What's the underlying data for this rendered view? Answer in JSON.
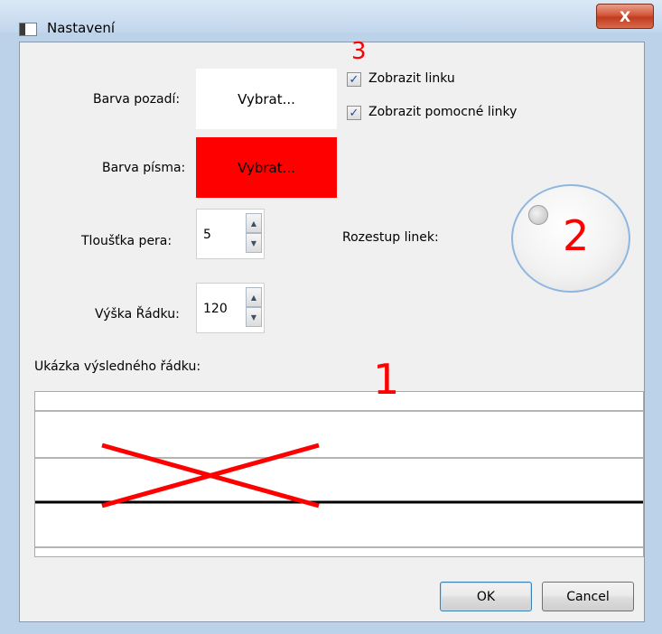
{
  "window": {
    "title": "Nastavení",
    "close_label": "X"
  },
  "form": {
    "background_color": {
      "label": "Barva pozadí:",
      "button_label": "Vybrat...",
      "color": "#ffffff"
    },
    "font_color": {
      "label": "Barva písma:",
      "button_label": "Vybrat...",
      "color": "#ff0000"
    },
    "pen_thickness": {
      "label": "Tloušťka pera:",
      "value": "5"
    },
    "row_height": {
      "label": "Výška Řádku:",
      "value": "120"
    },
    "show_line": {
      "label": "Zobrazit linku",
      "checked": true
    },
    "show_helper_lines": {
      "label": "Zobrazit pomocné linky",
      "checked": true
    },
    "line_spacing": {
      "label": "Rozestup linek:"
    }
  },
  "preview": {
    "label": "Ukázka výsledného řádku:"
  },
  "annotations": {
    "mark_1": "1",
    "mark_2": "2",
    "mark_3": "3",
    "color": "#ff0000"
  },
  "buttons": {
    "ok_label": "OK",
    "cancel_label": "Cancel"
  }
}
